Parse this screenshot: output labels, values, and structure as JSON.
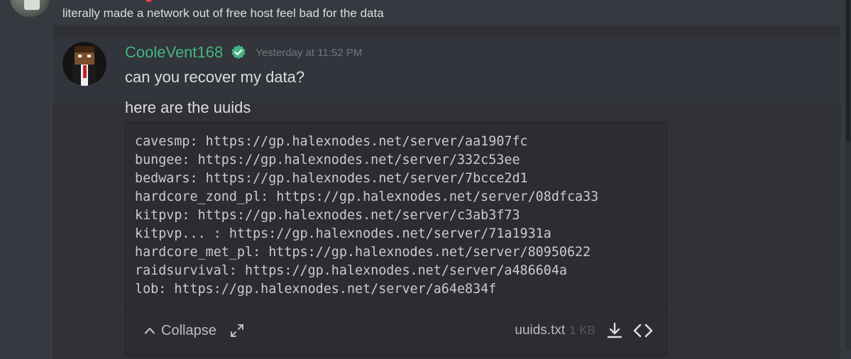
{
  "previous_message": {
    "text": "literally made a network out of free host feel bad for the data"
  },
  "message": {
    "author": "CooleVent168",
    "timestamp": "Yesterday at 11:52 PM",
    "lines": [
      "can you recover my data?",
      "here are the uuids"
    ]
  },
  "attachment": {
    "lines": [
      "cavesmp: https://gp.halexnodes.net/server/aa1907fc",
      "bungee: https://gp.halexnodes.net/server/332c53ee",
      "bedwars: https://gp.halexnodes.net/server/7bcce2d1",
      "hardcore_zond_pl: https://gp.halexnodes.net/server/08dfca33",
      "kitpvp: https://gp.halexnodes.net/server/c3ab3f73",
      "kitpvp... : https://gp.halexnodes.net/server/71a1931a",
      "hardcore_met_pl: https://gp.halexnodes.net/server/80950622",
      "raidsurvival: https://gp.halexnodes.net/server/a486604a",
      "lob: https://gp.halexnodes.net/server/a64e834f"
    ],
    "collapse_label": "Collapse",
    "file_name": "uuids.txt",
    "file_size": "1 KB"
  },
  "colors": {
    "background": "#36393f",
    "username": "#43b581",
    "verified": "#43b581",
    "timestamp": "#72767d",
    "code_background": "#2b2d31"
  },
  "icons": {
    "verified": "verified-badge-icon",
    "collapse": "chevron-up-icon",
    "expand": "expand-icon",
    "download": "download-icon",
    "view_code": "code-icon"
  }
}
